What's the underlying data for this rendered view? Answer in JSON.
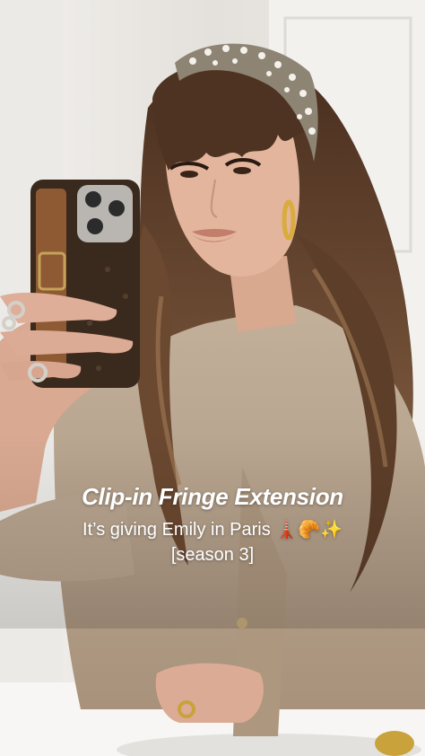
{
  "pin": {
    "title": "Clip-in Fringe Extension",
    "subtitle_line1": "It’s giving Emily in Paris 🗼🥐✨",
    "subtitle_line2": "[season 3]"
  },
  "scene": {
    "subject": "woman taking mirror selfie with phone",
    "accessories": [
      "pearl-embellished tweed headband",
      "gold hoop earrings",
      "brown monogram phone case with strap",
      "gold rings"
    ],
    "colors": {
      "background": "#ece9e5",
      "hair": "#5a3a24",
      "jacket": "#b9a58f",
      "skin": "#e0b49c",
      "phone_case": "#3d2a1e",
      "text": "#ffffff"
    }
  }
}
